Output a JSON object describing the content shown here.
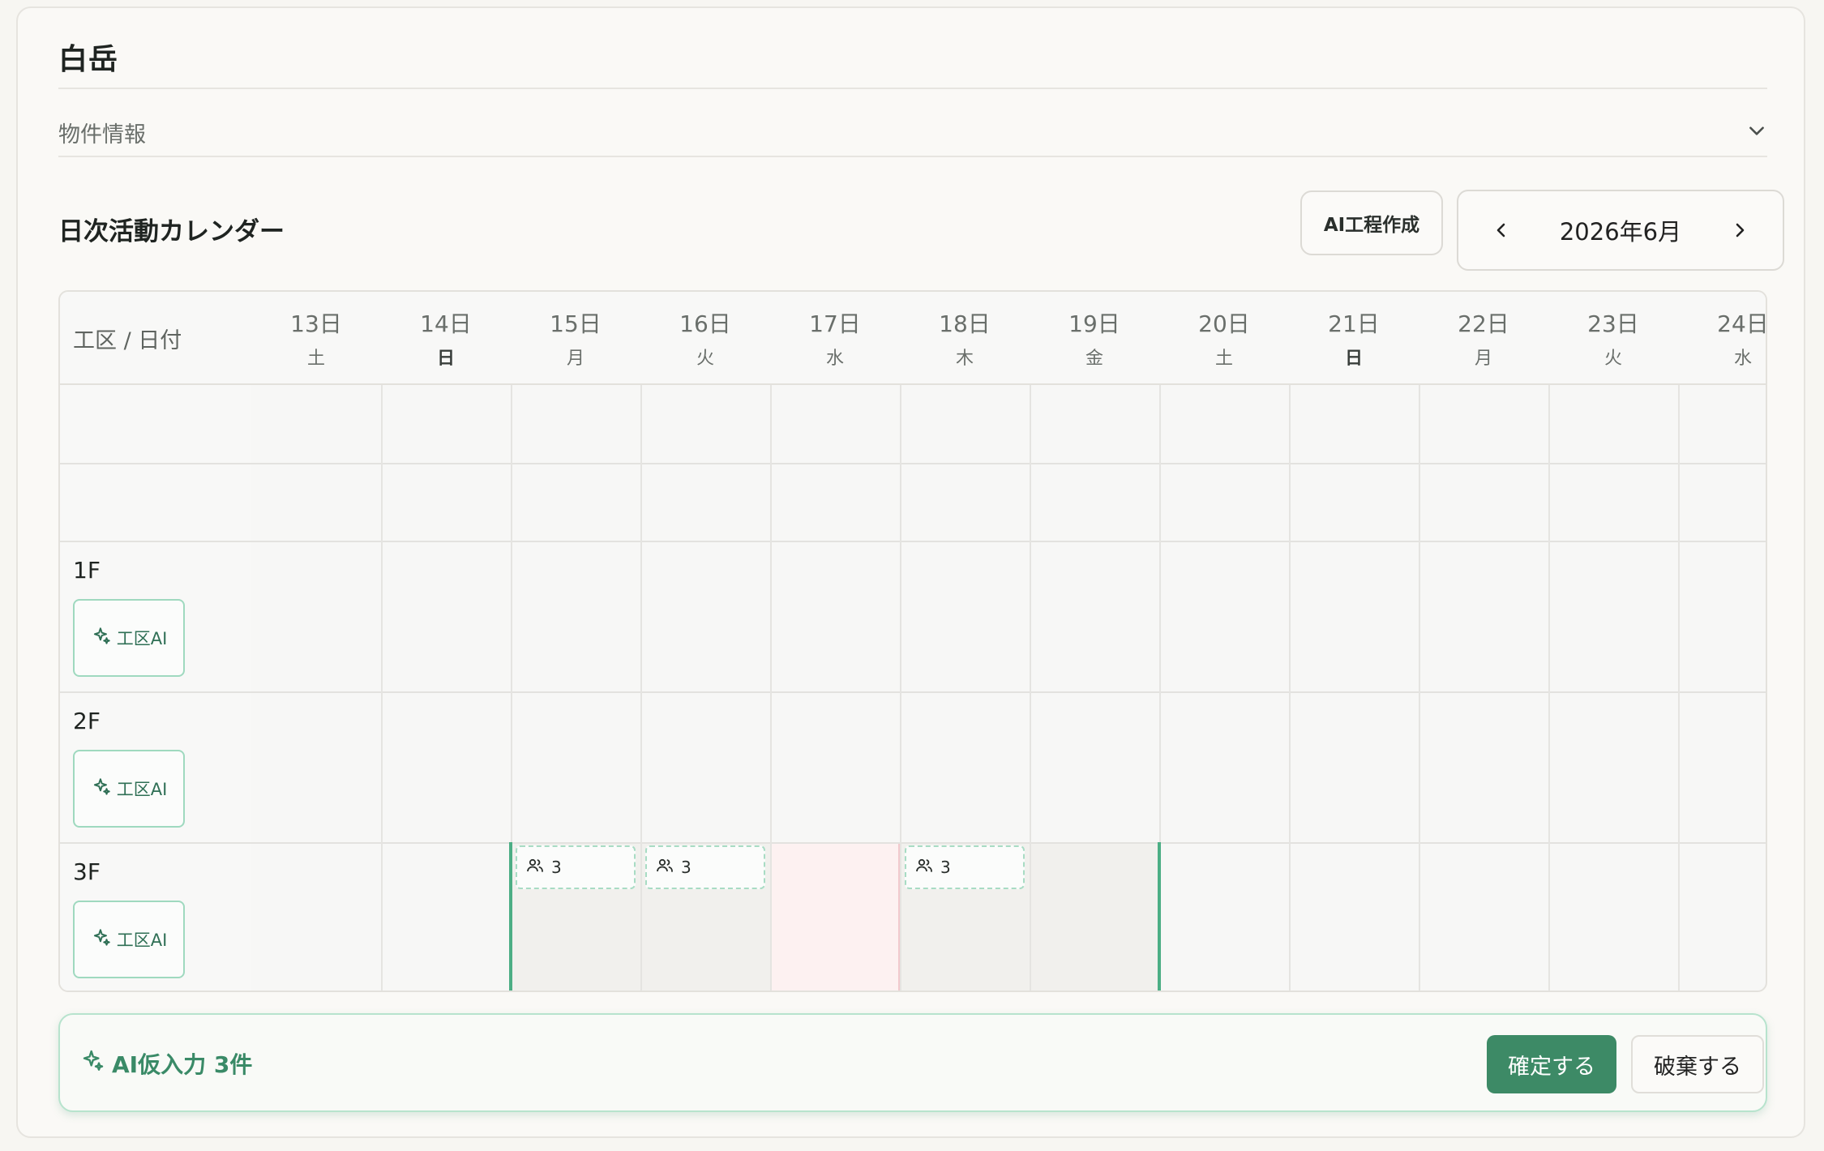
{
  "project": {
    "title": "白岳"
  },
  "accordion": {
    "label": "物件情報"
  },
  "calendar": {
    "title": "日次活動カレンダー",
    "ai_button": "AI工程作成",
    "month": "2026年6月",
    "corner": "工区 / 日付",
    "days": [
      {
        "num": "13日",
        "wd": "土"
      },
      {
        "num": "14日",
        "wd": "日"
      },
      {
        "num": "15日",
        "wd": "月"
      },
      {
        "num": "16日",
        "wd": "火"
      },
      {
        "num": "17日",
        "wd": "水"
      },
      {
        "num": "18日",
        "wd": "木"
      },
      {
        "num": "19日",
        "wd": "金"
      },
      {
        "num": "20日",
        "wd": "土"
      },
      {
        "num": "21日",
        "wd": "日"
      },
      {
        "num": "22日",
        "wd": "月"
      },
      {
        "num": "23日",
        "wd": "火"
      },
      {
        "num": "24日",
        "wd": "水"
      }
    ],
    "zones": [
      {
        "name": "1F",
        "ai_label": "工区AI"
      },
      {
        "name": "2F",
        "ai_label": "工区AI"
      },
      {
        "name": "3F",
        "ai_label": "工区AI"
      }
    ],
    "entries": [
      {
        "zone": "3F",
        "day": "15日",
        "count": "3"
      },
      {
        "zone": "3F",
        "day": "16日",
        "count": "3"
      },
      {
        "zone": "3F",
        "day": "18日",
        "count": "3"
      }
    ]
  },
  "ai_bar": {
    "label": "AI仮入力 3件",
    "confirm": "確定する",
    "discard": "破棄する"
  },
  "colors": {
    "accent": "#3d8a66",
    "accent_light": "#9fd9bf",
    "pink": "#fdf1f1"
  },
  "icons": {
    "sparkle": "sparkle-icon",
    "people": "people-icon",
    "chevron_down": "chevron-down-icon",
    "chevron_left": "chevron-left-icon",
    "chevron_right": "chevron-right-icon"
  }
}
